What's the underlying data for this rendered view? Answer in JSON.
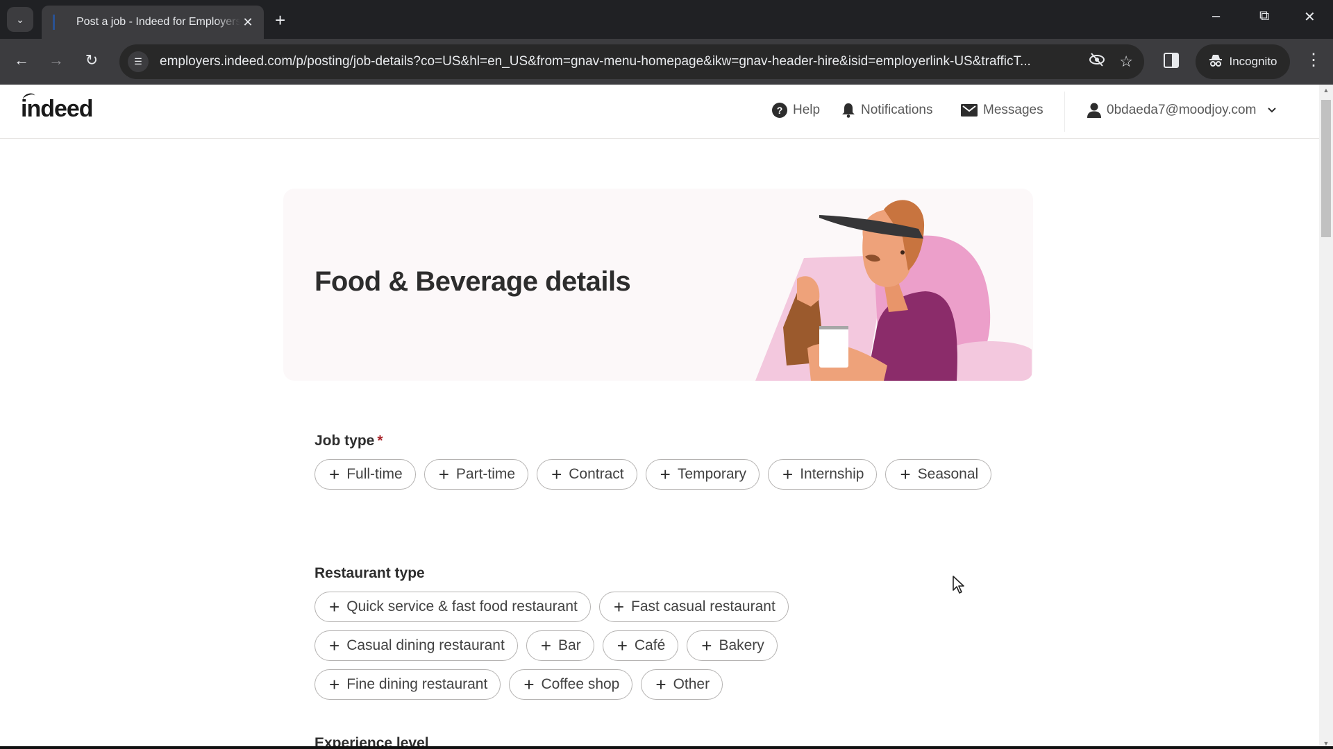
{
  "browser": {
    "tab_title": "Post a job - Indeed for Employers",
    "url": "employers.indeed.com/p/posting/job-details?co=US&hl=en_US&from=gnav-menu-homepage&ikw=gnav-header-hire&isid=employerlink-US&trafficT...",
    "incognito_label": "Incognito"
  },
  "header": {
    "logo": "indeed",
    "help_label": "Help",
    "notifications_label": "Notifications",
    "messages_label": "Messages",
    "account_email": "0bdaeda7@moodjoy.com"
  },
  "hero": {
    "title": "Food & Beverage details"
  },
  "job_type": {
    "label": "Job type",
    "required_marker": "*",
    "options": [
      "Full-time",
      "Part-time",
      "Contract",
      "Temporary",
      "Internship",
      "Seasonal"
    ]
  },
  "restaurant_type": {
    "label": "Restaurant type",
    "options": [
      "Quick service & fast food restaurant",
      "Fast casual restaurant",
      "Casual dining restaurant",
      "Bar",
      "Café",
      "Bakery",
      "Fine dining restaurant",
      "Coffee shop",
      "Other"
    ]
  },
  "experience_level": {
    "label": "Experience level"
  },
  "icons": {
    "chip_plus": "+"
  }
}
